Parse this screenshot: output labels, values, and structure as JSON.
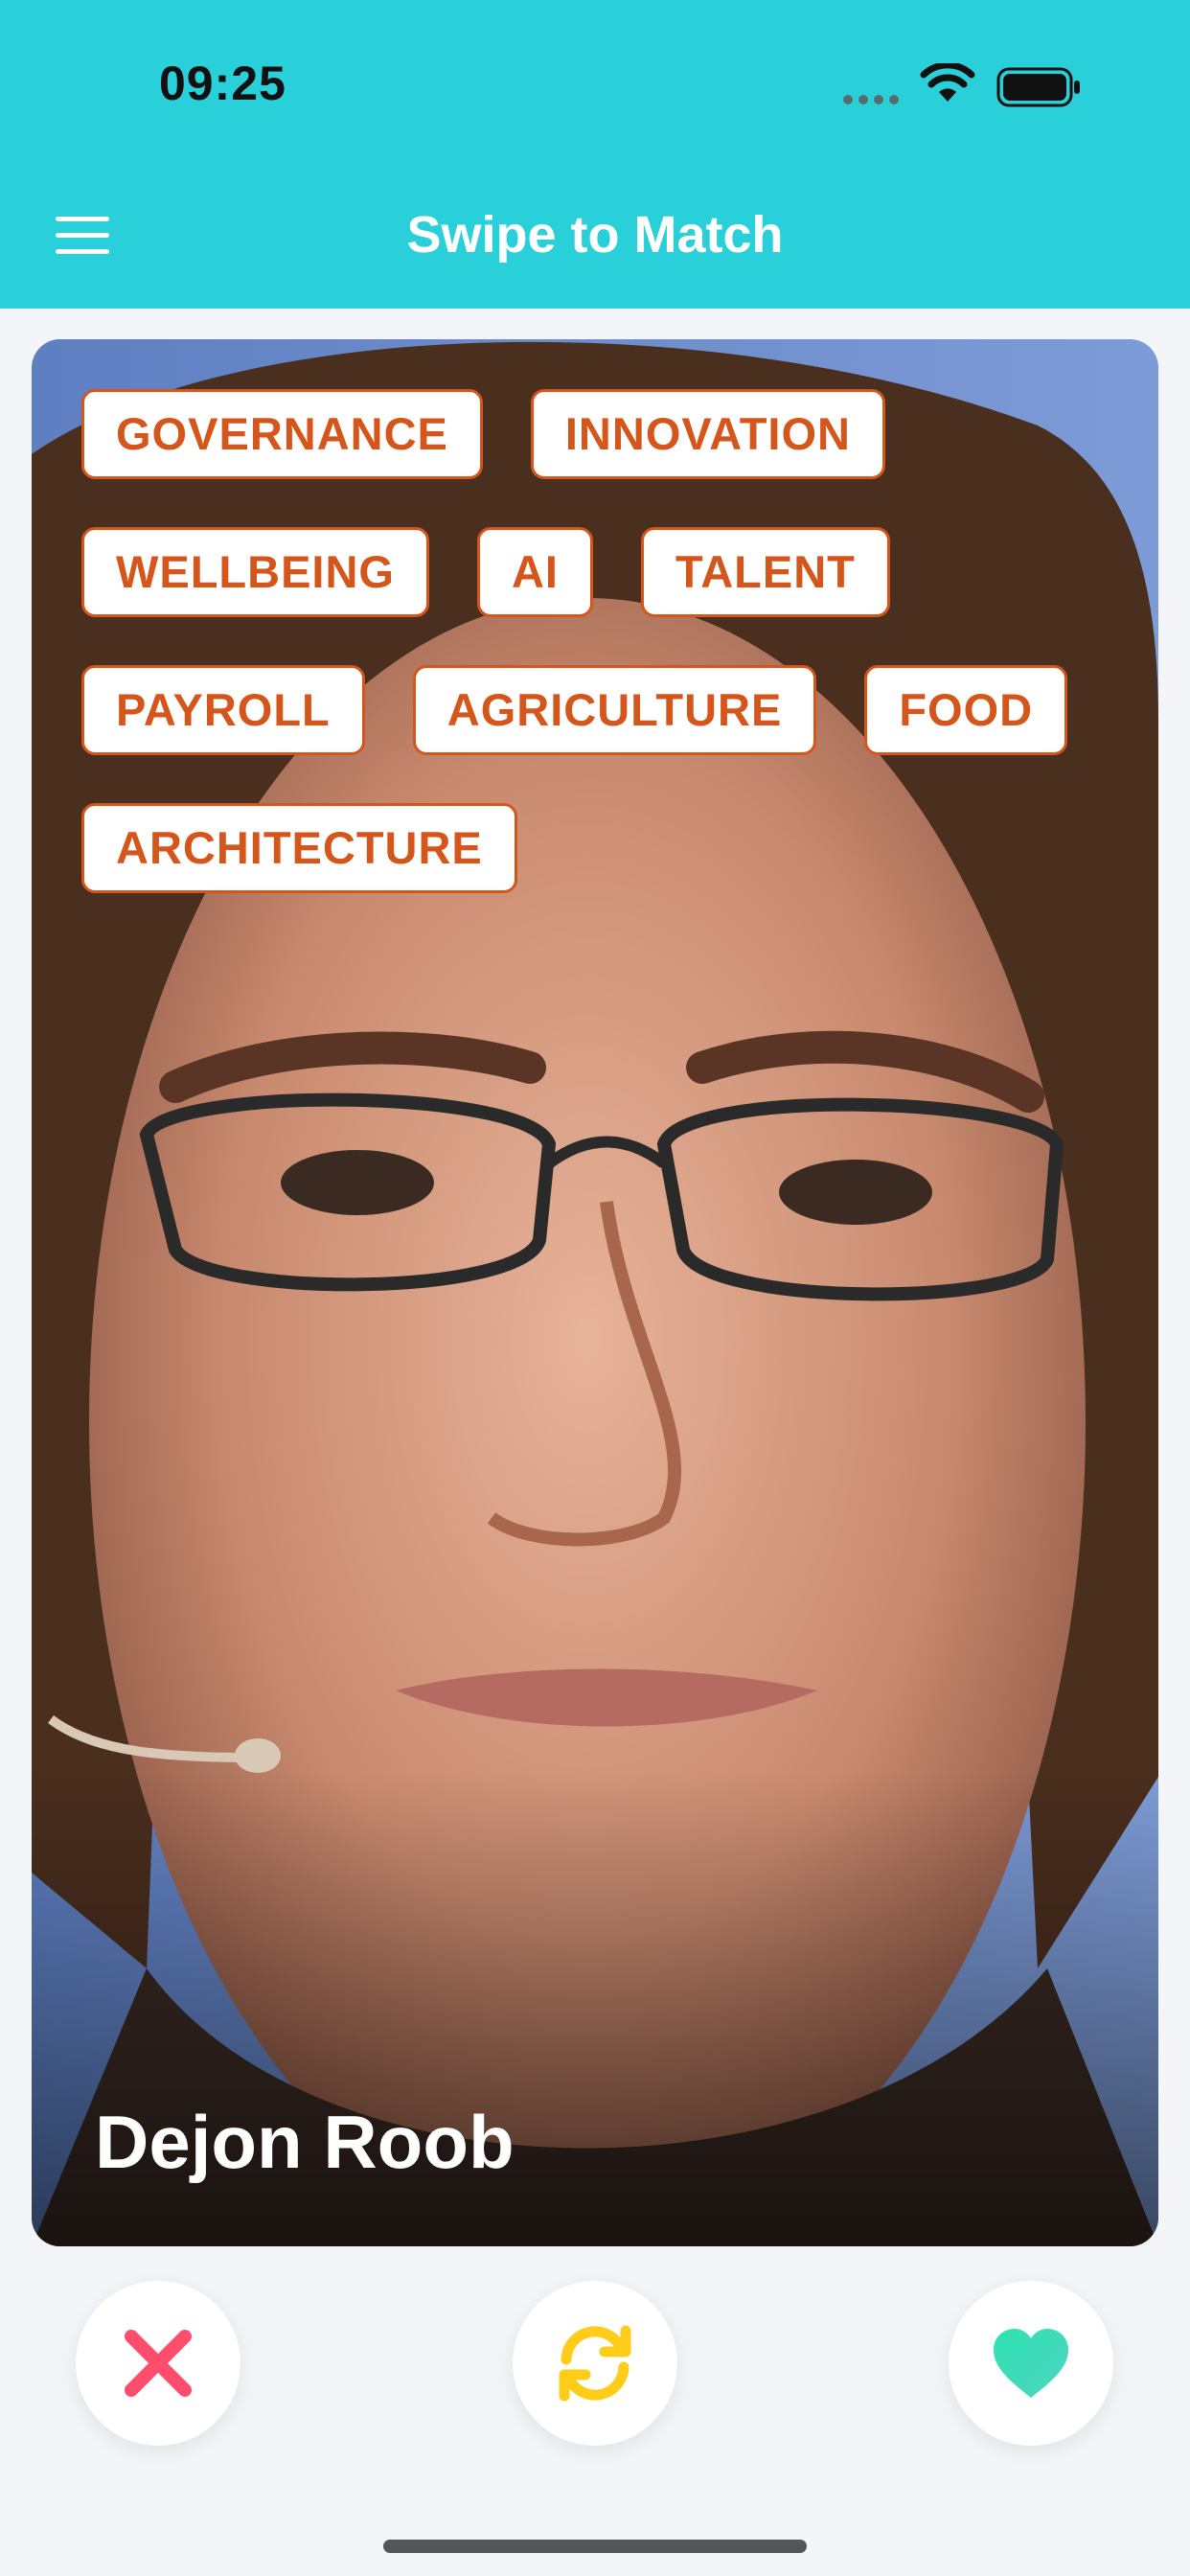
{
  "status_bar": {
    "time": "09:25"
  },
  "header": {
    "title": "Swipe to Match"
  },
  "card": {
    "tags": [
      "GOVERNANCE",
      "INNOVATION",
      "WELLBEING",
      "AI",
      "TALENT",
      "PAYROLL",
      "AGRICULTURE",
      "FOOD",
      "ARCHITECTURE"
    ],
    "name": "Dejon Roob"
  },
  "actions": {
    "dislike_icon": "close-icon",
    "refresh_icon": "refresh-icon",
    "like_icon": "heart-icon"
  },
  "colors": {
    "header": "#2ad0d9",
    "tag": "#d4561a",
    "dislike": "#ff4d6d",
    "refresh": "#ffcc1a",
    "like": "#2ee3b0"
  }
}
